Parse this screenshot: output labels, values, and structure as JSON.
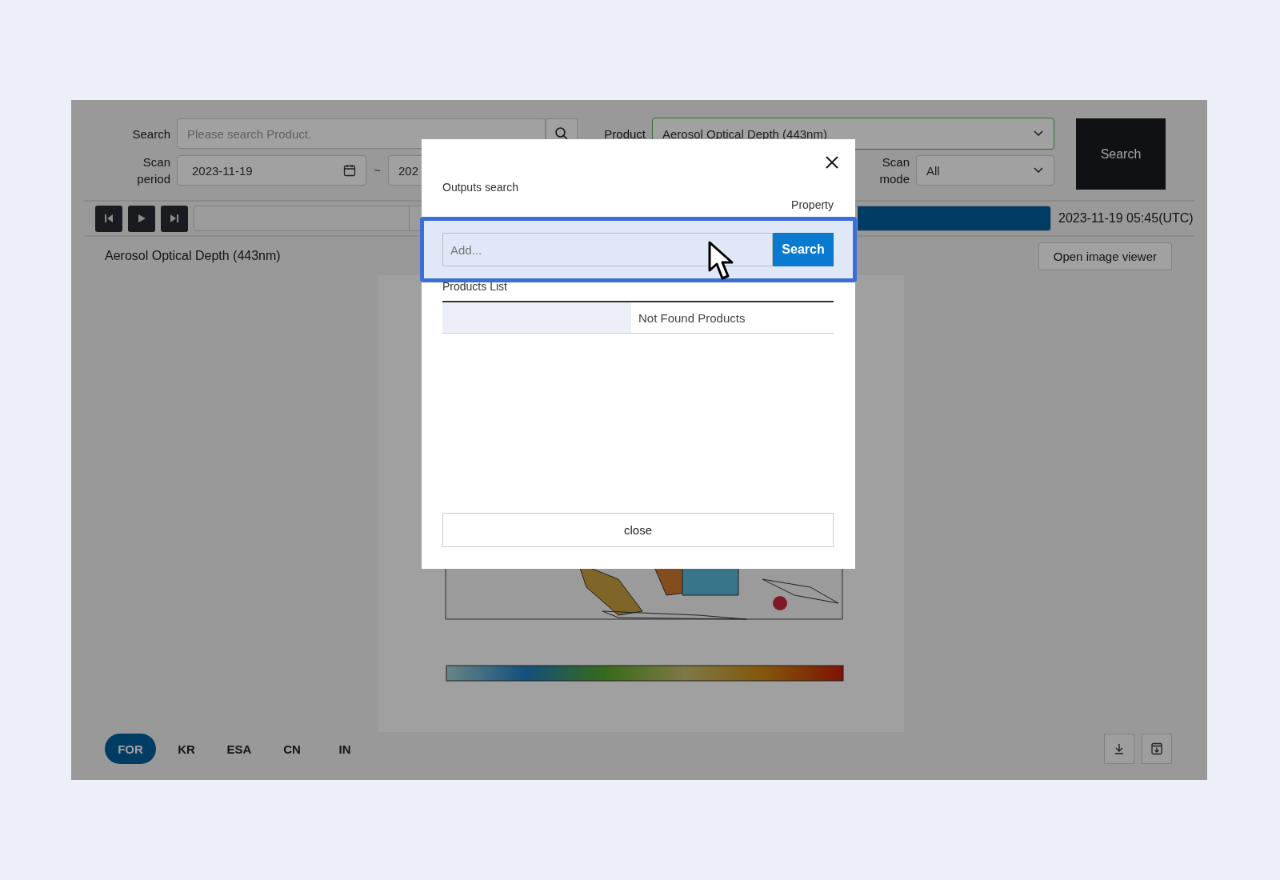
{
  "filters": {
    "search": {
      "label": "Search",
      "placeholder": "Please search Product."
    },
    "product": {
      "label": "Product",
      "value": "Aerosol Optical Depth (443nm)"
    },
    "search_button": "Search",
    "scan_period": {
      "label": "Scan period",
      "start": "2023-11-19",
      "separator": "~",
      "end": "202"
    },
    "scan_mode": {
      "label": "Scan mode",
      "value": "All"
    }
  },
  "timeline": {
    "time": "2023-11-19 05:45(UTC)"
  },
  "viewer": {
    "title": "Aerosol Optical Depth (443nm)",
    "open_button": "Open image viewer"
  },
  "region_tabs": [
    {
      "label": "FOR",
      "selected": true
    },
    {
      "label": "KR",
      "selected": false
    },
    {
      "label": "ESA",
      "selected": false
    },
    {
      "label": "CN",
      "selected": false
    },
    {
      "label": "IN",
      "selected": false
    }
  ],
  "modal": {
    "title": "Outputs search",
    "property_label": "Property",
    "input": {
      "placeholder": "Add..."
    },
    "search_button": "Search",
    "list_title": "Products List",
    "empty_message": "Not Found Products",
    "close_button": "close"
  }
}
